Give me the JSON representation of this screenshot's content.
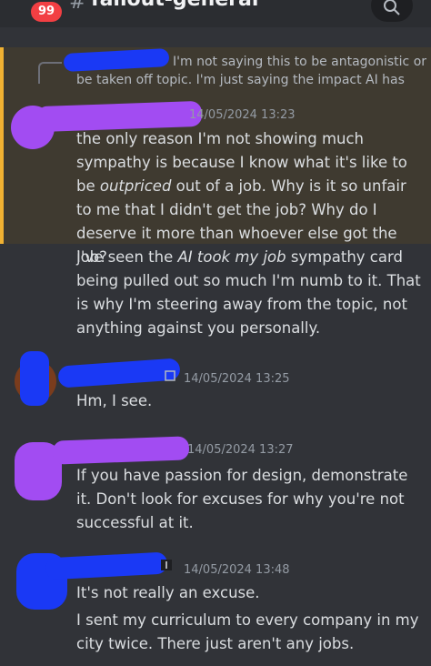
{
  "header": {
    "badge_count": "99",
    "channel_hash": "#",
    "channel_name": "fallout-general"
  },
  "reply": {
    "text": "I'm not saying this to be antagonistic or be taken off topic. I'm just saying the impact AI has"
  },
  "messages": [
    {
      "timestamp": "14/05/2024 13:23",
      "p1_a": "the only reason I'm not showing much sympathy is because I know what it's like to be ",
      "p1_em": "outpriced",
      "p1_b": " out of a job. Why is it so unfair to me that I didn't get the job? Why do I deserve it more than whoever else got the job?",
      "p2_a": "I've seen the ",
      "p2_em": "AI took my job",
      "p2_b": " sympathy card being pulled out so much I'm numb to it. That is why I'm steering away from the topic, not anything against you personally."
    },
    {
      "timestamp": "14/05/2024 13:25",
      "text": "Hm, I see."
    },
    {
      "timestamp": "14/05/2024 13:27",
      "text": "If you have passion for design, demonstrate it. Don't look for excuses for why you're not successful at it."
    },
    {
      "timestamp": "14/05/2024 13:48",
      "text1": "It's not really an excuse.",
      "text2": "I sent my curriculum to every company in my city twice. There just aren't any jobs."
    }
  ],
  "colors": {
    "background": "#313338",
    "highlight": "#3f3a30",
    "highlight_bar": "#f0b132",
    "redact_blue": "#1a39f5",
    "redact_purple": "#a24cf2",
    "badge": "#f23f43"
  },
  "icons": [
    "search-icon",
    "chevron-down-icon",
    "app-badge-icon"
  ]
}
